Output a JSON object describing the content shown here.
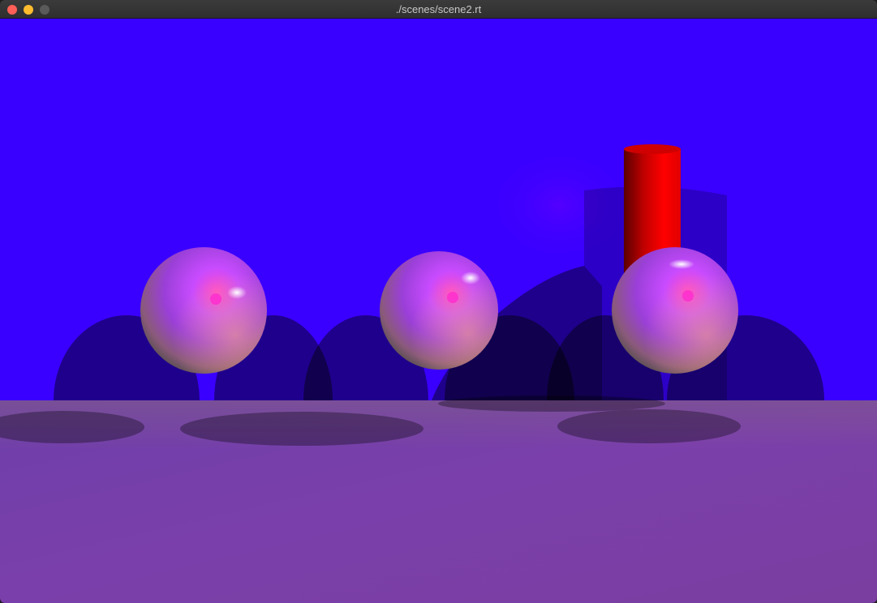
{
  "window": {
    "title": "./scenes/scene2.rt",
    "buttons": {
      "close_color": "#fe5f57",
      "minimize_color": "#febc2e",
      "zoom_color": "#5a5a5a"
    }
  },
  "render": {
    "background_color": "#3a00ff",
    "floor_color": "#7a3fae",
    "sphere_color": "#a43cff",
    "cylinder_color": "#ff0000",
    "shadow_color": "#000000",
    "objects": [
      {
        "type": "sphere",
        "name": "sphere-left"
      },
      {
        "type": "sphere",
        "name": "sphere-middle"
      },
      {
        "type": "sphere",
        "name": "sphere-right"
      },
      {
        "type": "cylinder",
        "name": "cylinder-red"
      },
      {
        "type": "plane",
        "name": "floor-plane"
      }
    ]
  }
}
